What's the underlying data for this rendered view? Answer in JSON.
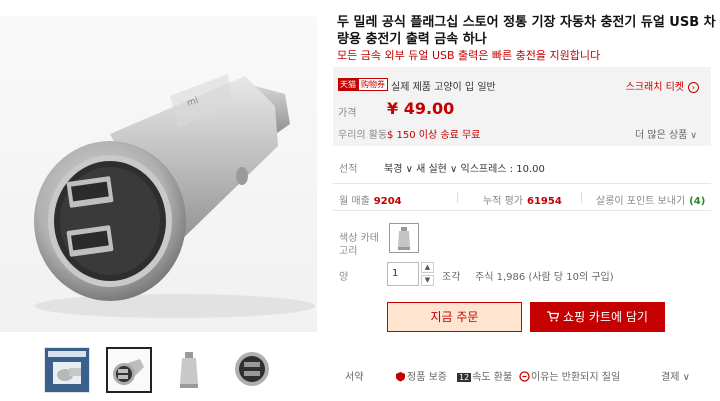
{
  "product": {
    "title": "두 밀레 공식 플래그십 스토어 정통 기장 자동차 충전기 듀얼 USB 차량용 충전기 출력 금속 하나",
    "subtitle": "모든 금속 외부 듀얼 USB 출력은 빠른 충전을 지원합니다"
  },
  "promo": {
    "badge_tmall": "天猫",
    "badge_shop": "购物券",
    "text": "실제 제품 고양이 입 일반",
    "scratch_label": "스크래치 티켓"
  },
  "price": {
    "label": "가격",
    "value": "¥ 49.00",
    "ship_label": "우리의 활동",
    "ship_text": "$ 150 이상 송료 무료",
    "more_label": "더 많은 상품"
  },
  "shipping": {
    "label": "선적",
    "value": "북경 ∨ 새 실현 ∨ 익스프레스 : 10.00"
  },
  "stats": {
    "monthly_label": "월 매출",
    "monthly_value": "9204",
    "reviews_label": "누적 평가",
    "reviews_value": "61954",
    "points_label": "살롱이 포인트 보내기",
    "points_value": "(4)"
  },
  "options": {
    "color_label": "색상 카테고리",
    "qty_label": "양",
    "qty_value": "1",
    "qty_unit": "조각",
    "stock_text": "주식 1,986 (사람 당 10의 구입)"
  },
  "buttons": {
    "buy_now": "지금 주문",
    "add_to_cart": "쇼핑 카트에 담기"
  },
  "bottom": {
    "item1": "서약",
    "item2": "정품 보증",
    "item3": "속도 환불",
    "item3_num": "12",
    "item4": "이유는 반환되지 칠일",
    "item5": "결제"
  },
  "colors": {
    "accent": "#c40000",
    "buy_bg": "#ffe4d0"
  }
}
